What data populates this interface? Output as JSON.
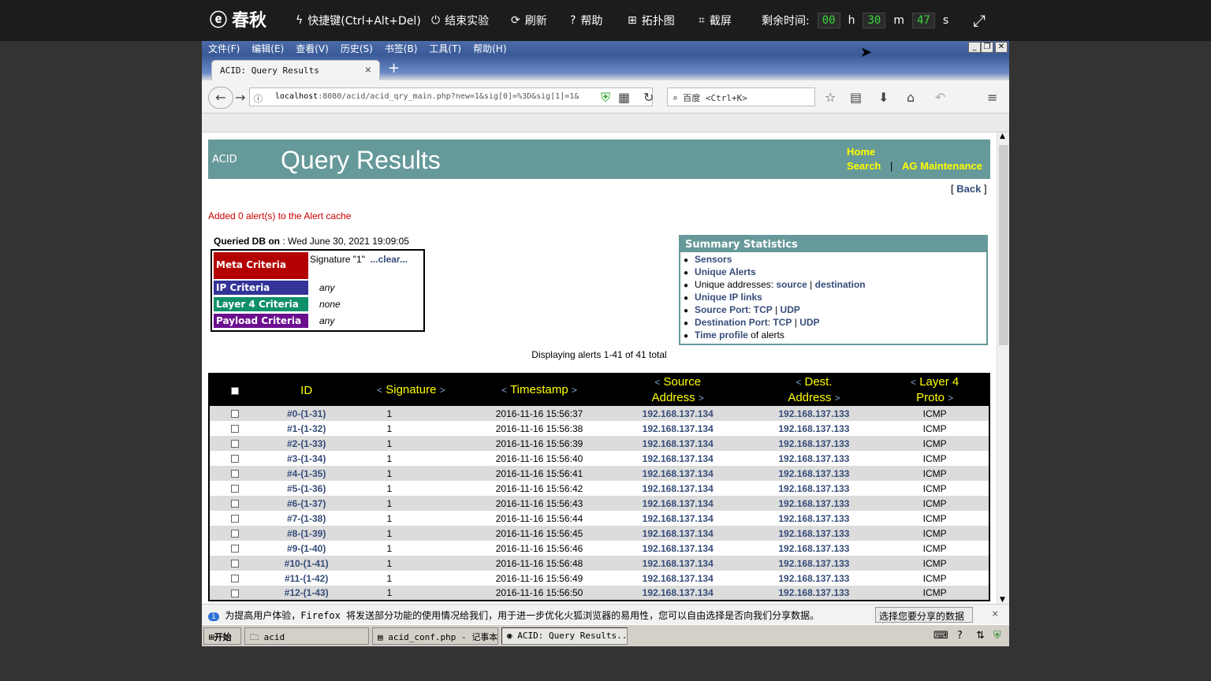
{
  "topbar": {
    "logo": "春秋",
    "shortcut": "快捷键(Ctrl+Alt+Del)",
    "end": "结束实验",
    "refresh": "刷新",
    "help": "帮助",
    "topo": "拓扑图",
    "screenshot": "截屏",
    "remaining": "剩余时间:",
    "h": "00",
    "m": "30",
    "s": "47",
    "h_unit": "h",
    "m_unit": "m",
    "s_unit": "s"
  },
  "menu": [
    "文件(F)",
    "编辑(E)",
    "查看(V)",
    "历史(S)",
    "书签(B)",
    "工具(T)",
    "帮助(H)"
  ],
  "tab": {
    "title": "ACID: Query Results"
  },
  "nav": {
    "url_host": "localhost",
    "url_rest": ":8080/acid/acid_qry_main.php?new=1&sig[0]=%3D&sig[1]=1&",
    "search_placeholder": "百度 <Ctrl+K>"
  },
  "page": {
    "acid": "ACID",
    "title": "Query Results",
    "home": "Home",
    "search": "Search",
    "sep": "|",
    "ag": "AG Maintenance",
    "back_open": "[",
    "back": "Back",
    "back_close": "]",
    "cache_msg": "Added 0 alert(s) to the Alert cache",
    "queried_label": "Queried DB on",
    "queried_value": " : Wed June 30, 2021 19:09:05",
    "criteria": {
      "meta": "Meta Criteria",
      "meta_value": "Signature \"1\"",
      "clear": "...clear...",
      "ip": "IP Criteria",
      "ip_value": "any",
      "l4": "Layer 4 Criteria",
      "l4_value": "none",
      "payload": "Payload Criteria",
      "payload_value": "any"
    },
    "summary": {
      "title": "Summary Statistics",
      "sensors": "Sensors",
      "unique_alerts": "Unique Alerts",
      "unique_addr": "Unique addresses: ",
      "source": "source",
      "pipe": "|",
      "destination": "destination",
      "ip_links": "Unique IP links",
      "src_port": "Source Port",
      "dst_port": "Destination Port",
      "colon": ": ",
      "tcp": "TCP",
      "udp": "UDP",
      "time_profile": "Time profile",
      "of_alerts": " of alerts"
    },
    "displaying": "Displaying alerts 1-41 of 41 total",
    "columns": {
      "id": "ID",
      "signature": "Signature",
      "timestamp": "Timestamp",
      "src1": "Source",
      "src2": "Address",
      "dst1": "Dest.",
      "dst2": "Address",
      "l41": "Layer 4",
      "l42": "Proto",
      "lt": "<",
      "gt": ">"
    },
    "rows": [
      {
        "id": "#0-(1-31)",
        "sig": "1",
        "ts": "2016-11-16 15:56:37",
        "src": "192.168.137.134",
        "dst": "192.168.137.133",
        "proto": "ICMP"
      },
      {
        "id": "#1-(1-32)",
        "sig": "1",
        "ts": "2016-11-16 15:56:38",
        "src": "192.168.137.134",
        "dst": "192.168.137.133",
        "proto": "ICMP"
      },
      {
        "id": "#2-(1-33)",
        "sig": "1",
        "ts": "2016-11-16 15:56:39",
        "src": "192.168.137.134",
        "dst": "192.168.137.133",
        "proto": "ICMP"
      },
      {
        "id": "#3-(1-34)",
        "sig": "1",
        "ts": "2016-11-16 15:56:40",
        "src": "192.168.137.134",
        "dst": "192.168.137.133",
        "proto": "ICMP"
      },
      {
        "id": "#4-(1-35)",
        "sig": "1",
        "ts": "2016-11-16 15:56:41",
        "src": "192.168.137.134",
        "dst": "192.168.137.133",
        "proto": "ICMP"
      },
      {
        "id": "#5-(1-36)",
        "sig": "1",
        "ts": "2016-11-16 15:56:42",
        "src": "192.168.137.134",
        "dst": "192.168.137.133",
        "proto": "ICMP"
      },
      {
        "id": "#6-(1-37)",
        "sig": "1",
        "ts": "2016-11-16 15:56:43",
        "src": "192.168.137.134",
        "dst": "192.168.137.133",
        "proto": "ICMP"
      },
      {
        "id": "#7-(1-38)",
        "sig": "1",
        "ts": "2016-11-16 15:56:44",
        "src": "192.168.137.134",
        "dst": "192.168.137.133",
        "proto": "ICMP"
      },
      {
        "id": "#8-(1-39)",
        "sig": "1",
        "ts": "2016-11-16 15:56:45",
        "src": "192.168.137.134",
        "dst": "192.168.137.133",
        "proto": "ICMP"
      },
      {
        "id": "#9-(1-40)",
        "sig": "1",
        "ts": "2016-11-16 15:56:46",
        "src": "192.168.137.134",
        "dst": "192.168.137.133",
        "proto": "ICMP"
      },
      {
        "id": "#10-(1-41)",
        "sig": "1",
        "ts": "2016-11-16 15:56:48",
        "src": "192.168.137.134",
        "dst": "192.168.137.133",
        "proto": "ICMP"
      },
      {
        "id": "#11-(1-42)",
        "sig": "1",
        "ts": "2016-11-16 15:56:49",
        "src": "192.168.137.134",
        "dst": "192.168.137.133",
        "proto": "ICMP"
      },
      {
        "id": "#12-(1-43)",
        "sig": "1",
        "ts": "2016-11-16 15:56:50",
        "src": "192.168.137.134",
        "dst": "192.168.137.133",
        "proto": "ICMP"
      }
    ]
  },
  "infobar": {
    "text": "为提高用户体验，Firefox 将发送部分功能的使用情况给我们，用于进一步优化火狐浏览器的易用性，您可以自由选择是否向我们分享数据。",
    "button": "选择您要分享的数据(C)"
  },
  "taskbar": {
    "start": "开始",
    "t1": "acid",
    "t2": "acid_conf.php - 记事本",
    "t3": "ACID: Query Results..."
  }
}
